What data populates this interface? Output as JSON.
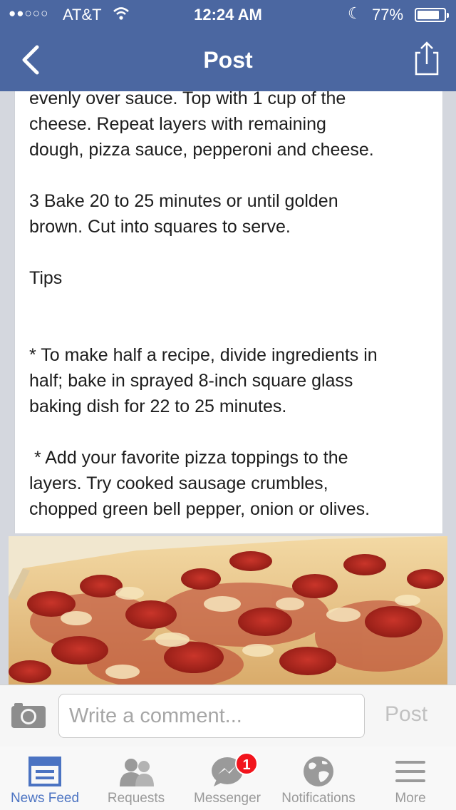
{
  "status_bar": {
    "signal": "●●○○○",
    "carrier": "AT&T",
    "time": "12:24 AM",
    "battery_percent": "77%",
    "battery_level": 0.77
  },
  "nav": {
    "title": "Post",
    "back_icon": "chevron-left-icon",
    "share_icon": "share-icon"
  },
  "post": {
    "text_lines": [
      "evenly over sauce. Top with 1 cup of the",
      "cheese. Repeat layers with remaining",
      "dough, pizza sauce, pepperoni and cheese.",
      "",
      "3 Bake 20 to 25 minutes or until golden",
      "brown. Cut into squares to serve.",
      "",
      "Tips",
      "",
      "",
      "* To make half a recipe, divide ingredients in",
      "half; bake in sprayed 8-inch square glass",
      "baking dish for 22 to 25 minutes.",
      "",
      " * Add your favorite pizza toppings to the",
      "layers. Try cooked sausage crumbles,",
      "chopped green bell pepper, onion or olives."
    ]
  },
  "comment_bar": {
    "placeholder": "Write a comment...",
    "post_label": "Post"
  },
  "tabs": [
    {
      "label": "News Feed",
      "icon": "news-feed-icon",
      "active": true
    },
    {
      "label": "Requests",
      "icon": "requests-icon",
      "active": false
    },
    {
      "label": "Messenger",
      "icon": "messenger-icon",
      "active": false,
      "badge": "1"
    },
    {
      "label": "Notifications",
      "icon": "globe-icon",
      "active": false
    },
    {
      "label": "More",
      "icon": "menu-icon",
      "active": false
    }
  ],
  "colors": {
    "header": "#4b67a1",
    "active_tab": "#4b73c2",
    "inactive_tab": "#9a9a9a",
    "badge": "#f2141c"
  }
}
